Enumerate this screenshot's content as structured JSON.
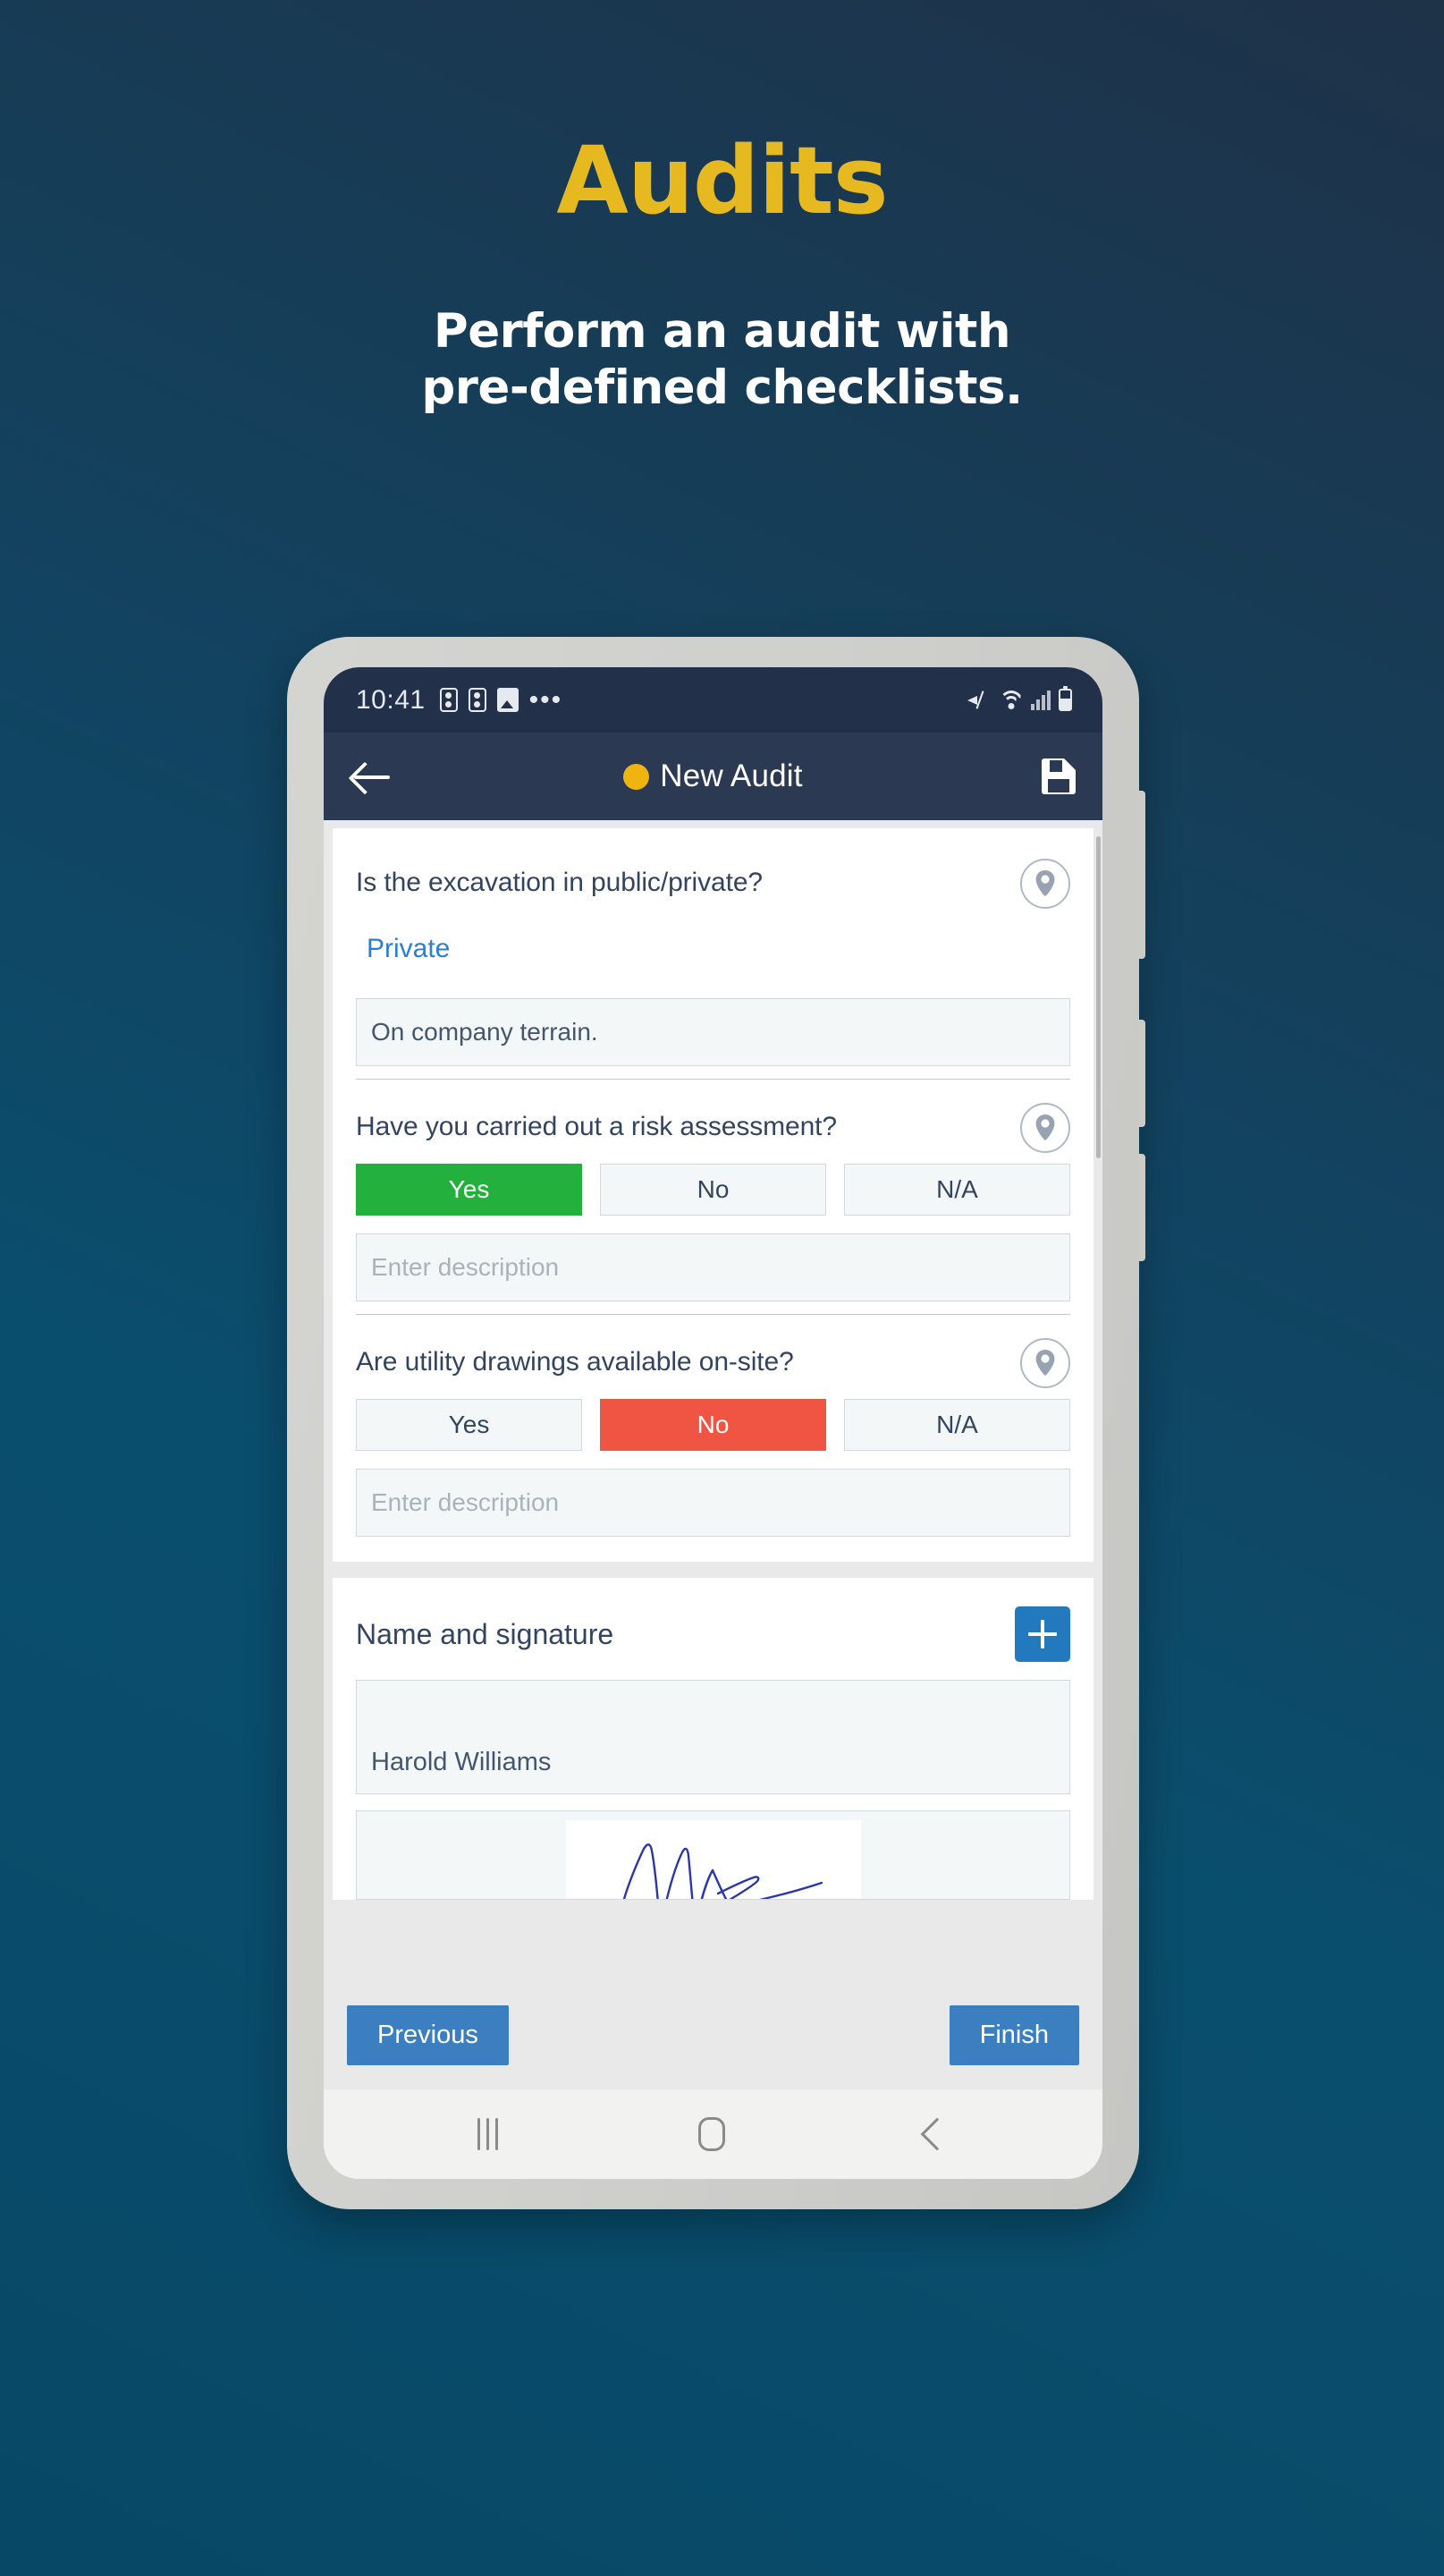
{
  "hero": {
    "title": "Audits",
    "subtitle_line1": "Perform an audit with",
    "subtitle_line2": "pre-defined checklists.",
    "title_color": "#e7b921",
    "subtitle_color": "#ffffff",
    "background_color": "#0a4e6e"
  },
  "statusbar": {
    "time": "10:41",
    "icons": [
      "app-icon",
      "app-icon",
      "image-icon",
      "more-dots-icon",
      "mute-icon",
      "wifi-icon",
      "signal-icon",
      "battery-icon"
    ]
  },
  "appbar": {
    "back_icon": "arrow-left-icon",
    "status_dot_color": "#efb410",
    "title": "New Audit",
    "save_icon": "save-floppy-icon"
  },
  "questions": [
    {
      "text": "Is the excavation in public/private?",
      "type": "choice-link",
      "answer": "Private",
      "answer_color": "#2a7fd4",
      "description_value": "On company terrain.",
      "description_placeholder": "Enter description",
      "location_icon": "location-pin-icon"
    },
    {
      "text": "Have you carried out a risk assessment?",
      "type": "yes-no-na",
      "options": [
        "Yes",
        "No",
        "N/A"
      ],
      "selected": "Yes",
      "selected_color": "#24b03c",
      "description_value": "",
      "description_placeholder": "Enter description",
      "location_icon": "location-pin-icon"
    },
    {
      "text": "Are utility drawings available on-site?",
      "type": "yes-no-na",
      "options": [
        "Yes",
        "No",
        "N/A"
      ],
      "selected": "No",
      "selected_color": "#f05442",
      "description_value": "",
      "description_placeholder": "Enter description",
      "location_icon": "location-pin-icon"
    }
  ],
  "signature_section": {
    "title": "Name and signature",
    "add_button_icon": "plus-icon",
    "add_button_color": "#2279bd",
    "name_value": "Harold Williams",
    "signature_present": true,
    "signature_ink_color": "#2b37a8"
  },
  "bottombar": {
    "previous_label": "Previous",
    "finish_label": "Finish",
    "button_color": "#3c7fc0"
  },
  "androidnav": {
    "recents_icon": "recents-icon",
    "home_icon": "home-icon",
    "back_icon": "back-icon"
  }
}
